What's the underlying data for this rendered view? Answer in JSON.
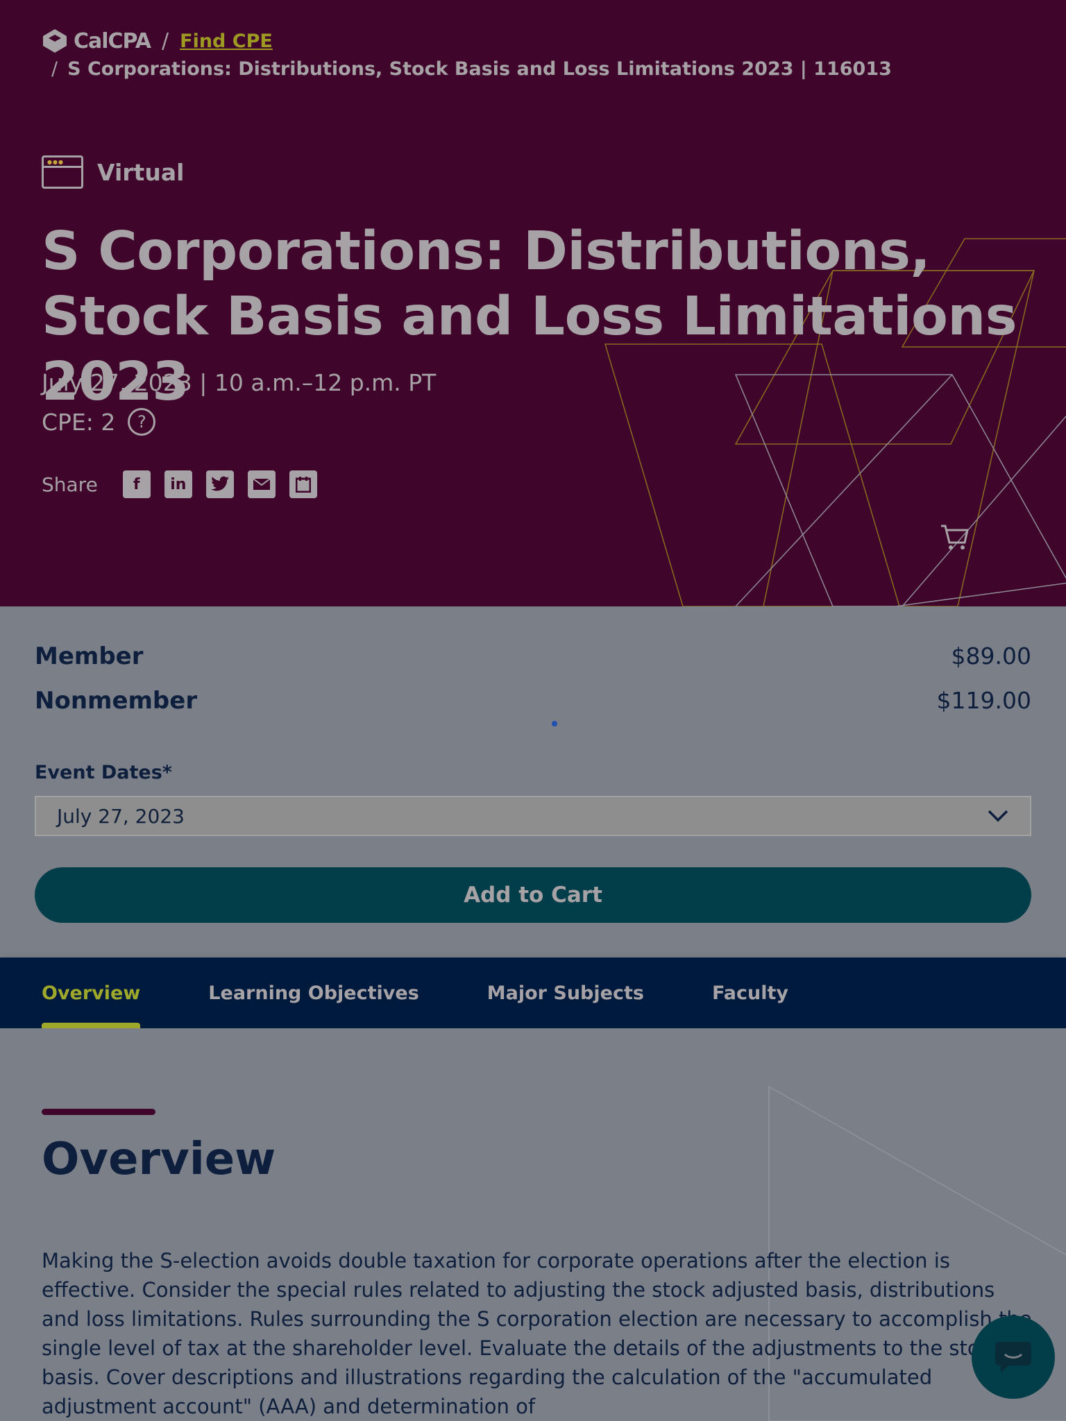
{
  "breadcrumb": {
    "logo_text": "CalCPA",
    "link": "Find CPE",
    "current": "S Corporations: Distributions, Stock Basis and Loss Limitations 2023 | 116013"
  },
  "event": {
    "format": "Virtual",
    "title": "S Corporations: Distributions, Stock Basis and Loss Limitations 2023",
    "date_time": "July 27, 2023 | 10 a.m.–12 p.m. PT",
    "cpe": "CPE: 2",
    "share_label": "Share"
  },
  "pricing": {
    "member_label": "Member",
    "member_price": "$89.00",
    "nonmember_label": "Nonmember",
    "nonmember_price": "$119.00",
    "dates_label": "Event Dates*",
    "selected_date": "July 27, 2023",
    "add_to_cart": "Add to Cart"
  },
  "tabs": [
    {
      "label": "Overview",
      "active": true
    },
    {
      "label": "Learning Objectives",
      "active": false
    },
    {
      "label": "Major Subjects",
      "active": false
    },
    {
      "label": "Faculty",
      "active": false
    }
  ],
  "overview": {
    "heading": "Overview",
    "body": "Making the S-election avoids double taxation for corporate operations after the election is effective. Consider the special rules related to adjusting the stock adjusted basis, distributions and loss limitations. Rules surrounding the S corporation election are necessary to accomplish the single level of tax at the shareholder level. Evaluate the details of the adjustments to the stock basis. Cover descriptions and illustrations regarding the calculation of the \"accumulated adjustment account\" (AAA) and determination of"
  },
  "colors": {
    "hero_bg": "#40052a",
    "accent_lime": "#9fa82a",
    "button_teal": "#023e49",
    "navy": "#001a3d"
  },
  "icons": [
    "calcpa-logo-icon",
    "virtual-browser-icon",
    "help-icon",
    "facebook-icon",
    "linkedin-icon",
    "twitter-icon",
    "email-icon",
    "calendar-icon",
    "cart-icon",
    "chevron-down-icon",
    "chat-icon"
  ]
}
